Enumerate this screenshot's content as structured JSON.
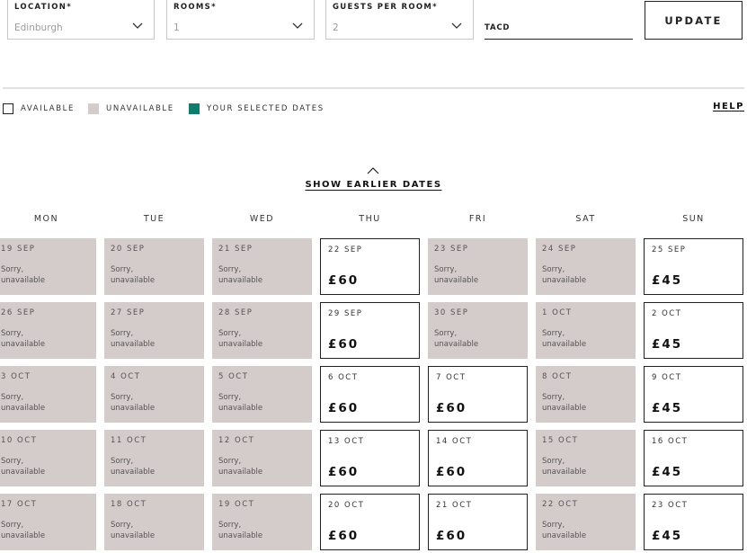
{
  "search": {
    "location": {
      "label": "LOCATION*",
      "value": "Edinburgh"
    },
    "rooms": {
      "label": "ROOMS*",
      "value": "1"
    },
    "guests": {
      "label": "GUESTS PER ROOM*",
      "value": "2"
    },
    "code": {
      "value": "TACD"
    },
    "update_label": "UPDATE"
  },
  "legend": {
    "available": "AVAILABLE",
    "unavailable": "UNAVAILABLE",
    "selected": "YOUR SELECTED DATES",
    "help": "HELP"
  },
  "colors": {
    "unavailable": "#d4cbcb",
    "selected": "#0f7b6c",
    "available_border": "#222222"
  },
  "calendar": {
    "show_earlier": "SHOW EARLIER DATES",
    "unavailable_text": "Sorry,\nunavailable",
    "days": [
      "MON",
      "TUE",
      "WED",
      "THU",
      "FRI",
      "SAT",
      "SUN"
    ],
    "weeks": [
      [
        {
          "date": "19 SEP",
          "price": null
        },
        {
          "date": "20 SEP",
          "price": null
        },
        {
          "date": "21 SEP",
          "price": null
        },
        {
          "date": "22 SEP",
          "price": "£60"
        },
        {
          "date": "23 SEP",
          "price": null
        },
        {
          "date": "24 SEP",
          "price": null
        },
        {
          "date": "25 SEP",
          "price": "£45"
        }
      ],
      [
        {
          "date": "26 SEP",
          "price": null
        },
        {
          "date": "27 SEP",
          "price": null
        },
        {
          "date": "28 SEP",
          "price": null
        },
        {
          "date": "29 SEP",
          "price": "£60"
        },
        {
          "date": "30 SEP",
          "price": null
        },
        {
          "date": "1 OCT",
          "price": null
        },
        {
          "date": "2 OCT",
          "price": "£45"
        }
      ],
      [
        {
          "date": "3 OCT",
          "price": null
        },
        {
          "date": "4 OCT",
          "price": null
        },
        {
          "date": "5 OCT",
          "price": null
        },
        {
          "date": "6 OCT",
          "price": "£60"
        },
        {
          "date": "7 OCT",
          "price": "£60"
        },
        {
          "date": "8 OCT",
          "price": null
        },
        {
          "date": "9 OCT",
          "price": "£45"
        }
      ],
      [
        {
          "date": "10 OCT",
          "price": null
        },
        {
          "date": "11 OCT",
          "price": null
        },
        {
          "date": "12 OCT",
          "price": null
        },
        {
          "date": "13 OCT",
          "price": "£60"
        },
        {
          "date": "14 OCT",
          "price": "£60"
        },
        {
          "date": "15 OCT",
          "price": null
        },
        {
          "date": "16 OCT",
          "price": "£45"
        }
      ],
      [
        {
          "date": "17 OCT",
          "price": null
        },
        {
          "date": "18 OCT",
          "price": null
        },
        {
          "date": "19 OCT",
          "price": null
        },
        {
          "date": "20 OCT",
          "price": "£60"
        },
        {
          "date": "21 OCT",
          "price": "£60"
        },
        {
          "date": "22 OCT",
          "price": null
        },
        {
          "date": "23 OCT",
          "price": "£45"
        }
      ]
    ]
  }
}
